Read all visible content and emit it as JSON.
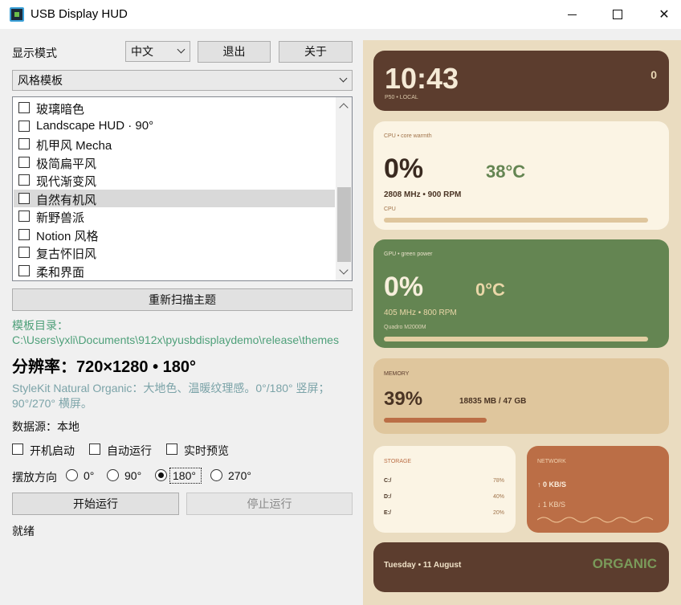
{
  "window": {
    "title": "USB Display HUD",
    "icon": "app-icon"
  },
  "controls": {
    "display_mode_label": "显示模式",
    "language_value": "中文",
    "exit_button": "退出",
    "about_button": "关于",
    "template_combo": "风格模板"
  },
  "theme_list": [
    "玻璃暗色",
    "Landscape HUD · 90°",
    "机甲风 Mecha",
    "极简扁平风",
    "现代渐变风",
    "自然有机风",
    "新野兽派",
    "Notion 风格",
    "复古怀旧风",
    "柔和界面"
  ],
  "theme_list_selected_index": 5,
  "rescan_button": "重新扫描主题",
  "template_dir": "模板目录：C:\\Users\\yxli\\Documents\\912x\\pyusbdisplaydemo\\release\\themes",
  "resolution": "分辨率：720×1280 • 180°",
  "description": "StyleKit Natural Organic：大地色、温暖纹理感。0°/180° 竖屏；90°/270° 横屏。",
  "data_source": "数据源：本地",
  "options": {
    "autostart": "开机启动",
    "autorun": "自动运行",
    "live_preview": "实时预览"
  },
  "orientation": {
    "label": "摆放方向",
    "choices": [
      "0°",
      "90°",
      "180°",
      "270°"
    ],
    "selected": "180°"
  },
  "start_button": "开始运行",
  "stop_button": "停止运行",
  "status": "就绪",
  "preview": {
    "clock": "10:43",
    "clock_sub": "P50 • LOCAL",
    "clock_badge": "0",
    "cpu": {
      "title": "CPU • core warmth",
      "usage": "0%",
      "temp": "38°C",
      "detail": "2808 MHz • 900 RPM",
      "name": "CPU",
      "usage_fraction": 0.0
    },
    "gpu": {
      "title": "GPU • green power",
      "usage": "0%",
      "temp": "0°C",
      "detail": "405 MHz • 800 RPM",
      "name": "Quadro M2000M",
      "usage_fraction": 0.0
    },
    "memory": {
      "title": "MEMORY",
      "usage": "39%",
      "detail": "18835 MB / 47 GB",
      "usage_fraction": 0.39
    },
    "storage": {
      "title": "STORAGE",
      "drives": [
        {
          "name": "C:/",
          "value": "78%"
        },
        {
          "name": "D:/",
          "value": "40%"
        },
        {
          "name": "E:/",
          "value": "20%"
        }
      ]
    },
    "network": {
      "title": "NETWORK",
      "up": "↑ 0 KB/S",
      "down": "↓ 1 KB/S"
    },
    "date": "Tuesday • 11 August",
    "theme_name": "ORGANIC"
  },
  "colors": {
    "accent_green": "#4fa07a",
    "dark_brown": "#5c3d2e",
    "olive_green": "#648552",
    "terracotta": "#bb6e46",
    "sand": "#eadcc0"
  }
}
